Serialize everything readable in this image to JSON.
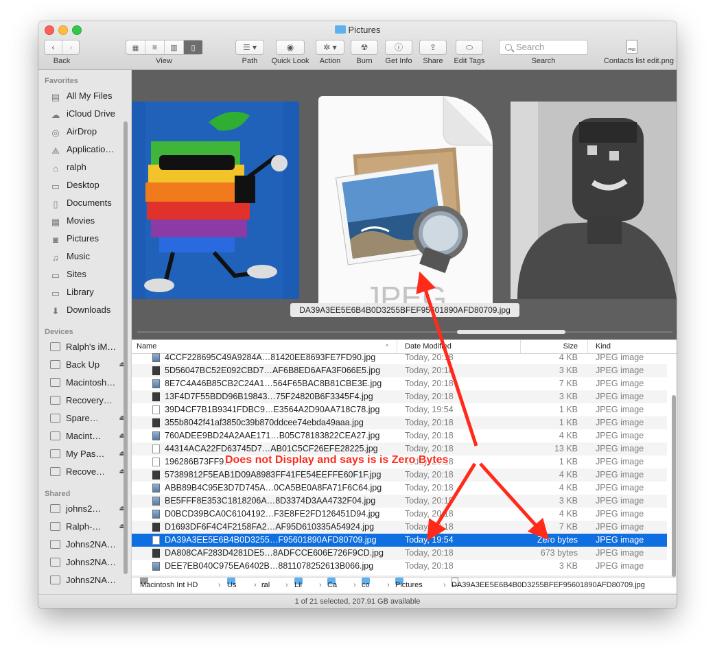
{
  "window": {
    "title": "Pictures"
  },
  "toolbar": {
    "back_label": "Back",
    "view_label": "View",
    "path_label": "Path",
    "quicklook_label": "Quick Look",
    "action_label": "Action",
    "burn_label": "Burn",
    "getinfo_label": "Get Info",
    "share_label": "Share",
    "edittags_label": "Edit Tags",
    "search_placeholder": "Search",
    "search_label": "Search",
    "recent_file_label": "Contacts list edit.png",
    "recent_file_badge": "PNG"
  },
  "sidebar": {
    "favorites_header": "Favorites",
    "favorites": [
      {
        "label": "All My Files",
        "icon": "all-files-icon"
      },
      {
        "label": "iCloud Drive",
        "icon": "cloud-icon"
      },
      {
        "label": "AirDrop",
        "icon": "airdrop-icon"
      },
      {
        "label": "Applicatio…",
        "icon": "applications-icon"
      },
      {
        "label": "ralph",
        "icon": "home-icon"
      },
      {
        "label": "Desktop",
        "icon": "desktop-icon"
      },
      {
        "label": "Documents",
        "icon": "documents-icon"
      },
      {
        "label": "Movies",
        "icon": "movies-icon"
      },
      {
        "label": "Pictures",
        "icon": "camera-icon"
      },
      {
        "label": "Music",
        "icon": "music-icon"
      },
      {
        "label": "Sites",
        "icon": "folder-icon"
      },
      {
        "label": "Library",
        "icon": "folder-icon"
      },
      {
        "label": "Downloads",
        "icon": "downloads-icon"
      }
    ],
    "devices_header": "Devices",
    "devices": [
      {
        "label": "Ralph's iM…",
        "eject": false
      },
      {
        "label": "Back Up",
        "eject": true
      },
      {
        "label": "Macintosh…",
        "eject": false
      },
      {
        "label": "Recovery…",
        "eject": false
      },
      {
        "label": "Spare…",
        "eject": true
      },
      {
        "label": "Macint…",
        "eject": true
      },
      {
        "label": "My Pas…",
        "eject": true
      },
      {
        "label": "Recove…",
        "eject": true
      }
    ],
    "shared_header": "Shared",
    "shared": [
      {
        "label": "johns2…",
        "eject": true
      },
      {
        "label": "Ralph-…",
        "eject": true
      },
      {
        "label": "Johns2NA…",
        "eject": false
      },
      {
        "label": "Johns2NA…",
        "eject": false
      },
      {
        "label": "Johns2NA…",
        "eject": false
      }
    ]
  },
  "preview": {
    "doc_label": "JPEG",
    "caption": "DA39A3EE5E6B4B0D3255BFEF95601890AFD80709.jpg"
  },
  "columns": {
    "name": "Name",
    "date": "Date Modified",
    "size": "Size",
    "kind": "Kind"
  },
  "files": [
    {
      "name": "4CCF228695C49A9284A…81420EE8693FE7FD90.jpg",
      "date": "Today, 20:18",
      "size": "4 KB",
      "kind": "JPEG image",
      "icon": "img"
    },
    {
      "name": "5D56047BC52E092CBD7…AF6B8ED6AFA3F066E5.jpg",
      "date": "Today, 20:18",
      "size": "3 KB",
      "kind": "JPEG image",
      "icon": "dark"
    },
    {
      "name": "8E7C4A46B85CB2C24A1…564F65BAC8B81CBE3E.jpg",
      "date": "Today, 20:18",
      "size": "7 KB",
      "kind": "JPEG image",
      "icon": "img"
    },
    {
      "name": "13F4D7F55BDD96B19843…75F24820B6F3345F4.jpg",
      "date": "Today, 20:18",
      "size": "3 KB",
      "kind": "JPEG image",
      "icon": "dark"
    },
    {
      "name": "39D4CF7B1B9341FDBC9…E3564A2D90AA718C78.jpg",
      "date": "Today, 19:54",
      "size": "1 KB",
      "kind": "JPEG image",
      "icon": "plain"
    },
    {
      "name": "355b8042f41af3850c39b870ddcee74ebda49aaa.jpg",
      "date": "Today, 20:18",
      "size": "1 KB",
      "kind": "JPEG image",
      "icon": "dark"
    },
    {
      "name": "760ADEE9BD24A2AAE171…B05C78183822CEA27.jpg",
      "date": "Today, 20:18",
      "size": "4 KB",
      "kind": "JPEG image",
      "icon": "img"
    },
    {
      "name": "44314ACA22FD63745D7…AB01C5CF26EFE28225.jpg",
      "date": "Today, 20:18",
      "size": "13 KB",
      "kind": "JPEG image",
      "icon": "plain"
    },
    {
      "name": "196286B73FF9…",
      "date": "Today, 20:18",
      "size": "1 KB",
      "kind": "JPEG image",
      "icon": "plain"
    },
    {
      "name": "57389812F5EAB1D09A8983FF41FE54EEFFE60F1F.jpg",
      "date": "Today, 20:18",
      "size": "4 KB",
      "kind": "JPEG image",
      "icon": "dark"
    },
    {
      "name": "ABB89B4C95E3D7D745A…0CA5BE0A8FA71F6C64.jpg",
      "date": "Today, 20:18",
      "size": "4 KB",
      "kind": "JPEG image",
      "icon": "img"
    },
    {
      "name": "BE5FFF8E353C1818206A…8D3374D3AA4732F04.jpg",
      "date": "Today, 20:18",
      "size": "3 KB",
      "kind": "JPEG image",
      "icon": "img"
    },
    {
      "name": "D0BCD39BCA0C6104192…F3E8FE2FD126451D94.jpg",
      "date": "Today, 20:18",
      "size": "4 KB",
      "kind": "JPEG image",
      "icon": "img"
    },
    {
      "name": "D1693DF6F4C4F2158FA2…AF95D610335A54924.jpg",
      "date": "Today, 20:18",
      "size": "7 KB",
      "kind": "JPEG image",
      "icon": "dark"
    },
    {
      "name": "DA39A3EE5E6B4B0D3255…F95601890AFD80709.jpg",
      "date": "Today, 19:54",
      "size": "Zero bytes",
      "kind": "JPEG image",
      "icon": "plain",
      "selected": true
    },
    {
      "name": "DA808CAF283D4281DE5…8ADFCCE606E726F9CD.jpg",
      "date": "Today, 20:18",
      "size": "673 bytes",
      "kind": "JPEG image",
      "icon": "dark"
    },
    {
      "name": "DEE7EB040C975EA6402B…8811078252613B066.jpg",
      "date": "Today, 20:18",
      "size": "3 KB",
      "kind": "JPEG image",
      "icon": "img"
    }
  ],
  "pathbar": {
    "items": [
      "Macintosh Int HD",
      "Us",
      "ral",
      "Lil",
      "Ca",
      "co",
      "Pictures",
      "DA39A3EE5E6B4B0D3255BFEF95601890AFD80709.jpg"
    ]
  },
  "status": {
    "text": "1 of 21 selected, 207.91 GB available"
  },
  "annotation": {
    "text": "Does not Display and says is is Zero Bytes",
    "color": "#ff2a1a"
  }
}
